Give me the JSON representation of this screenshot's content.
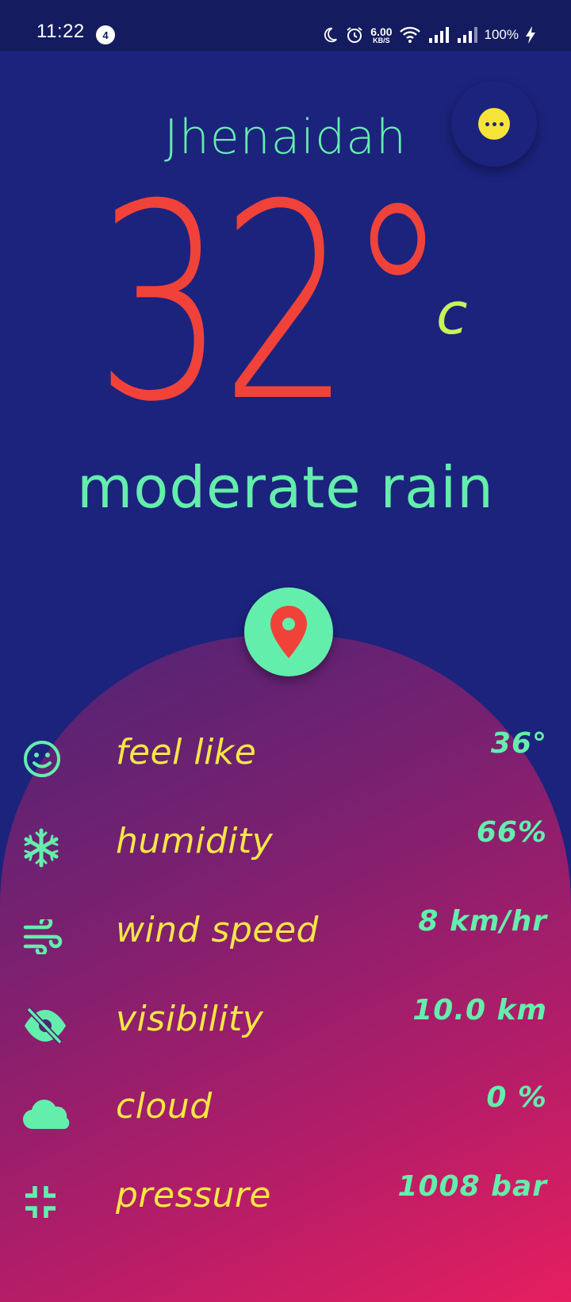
{
  "status_bar": {
    "time": "11:22",
    "notification_count": "4",
    "net_speed_value": "6.00",
    "net_speed_unit": "KB/S",
    "battery": "100%"
  },
  "location": {
    "city": "Jhenaidah"
  },
  "current": {
    "temperature": "32°",
    "unit": "c",
    "condition": "moderate rain"
  },
  "details": [
    {
      "icon": "smile-icon",
      "label": "feel like",
      "value": "36°"
    },
    {
      "icon": "snowflake-icon",
      "label": "humidity",
      "value": "66%"
    },
    {
      "icon": "wind-icon",
      "label": "wind speed",
      "value": "8 km/hr"
    },
    {
      "icon": "eye-off-icon",
      "label": "visibility",
      "value": "10.0 km"
    },
    {
      "icon": "cloud-icon",
      "label": "cloud",
      "value": "0 %"
    },
    {
      "icon": "compress-icon",
      "label": "pressure",
      "value": "1008 bar"
    }
  ],
  "colors": {
    "background": "#1b237d",
    "status_bar": "#141b5e",
    "accent_green": "#64eeac",
    "accent_yellow": "#f6e646",
    "temperature_red": "#f1423a",
    "unit_lime": "#c8f25a"
  }
}
